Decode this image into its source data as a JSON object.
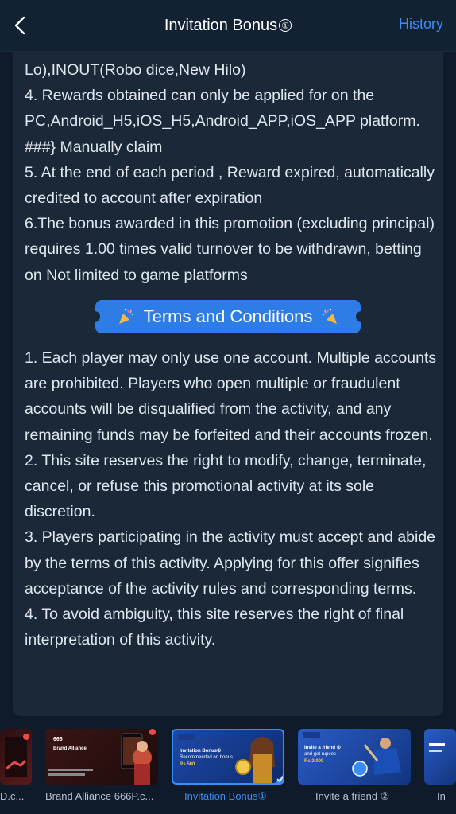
{
  "header": {
    "title": "Invitation Bonus",
    "info_icon": "①",
    "history_label": "History"
  },
  "rules": [
    "Lo),INOUT(Robo dice,New Hilo)",
    "4. Rewards obtained can only be applied for on the PC,Android_H5,iOS_H5,Android_APP,iOS_APP platform. ###} Manually claim",
    "5. At the end of each period , Reward expired, automatically credited to account after expiration",
    "6.The bonus awarded in this promotion (excluding principal) requires 1.00 times valid turnover to be withdrawn, betting on Not limited to game platforms"
  ],
  "terms_title": "Terms and Conditions",
  "terms": [
    "1. Each player may only use one account. Multiple accounts are prohibited. Players who open multiple or fraudulent accounts will be disqualified from the activity, and any remaining funds may be forfeited and their accounts frozen.",
    "2. This site reserves the right to modify, change, terminate, cancel, or refuse this promotional activity at its sole discretion.",
    "3. Players participating in the activity must accept and abide by the terms of this activity. Applying for this offer signifies acceptance of the activity rules and corresponding terms.",
    "4. To avoid ambiguity, this site reserves the right of final interpretation of this activity."
  ],
  "promos": [
    {
      "label": "D.c...",
      "active": false
    },
    {
      "label": "Brand Alliance 666P.c...",
      "active": false,
      "thumb_title": "Brand Alliance",
      "thumb_brand": "666"
    },
    {
      "label": "Invitation Bonus①",
      "active": true,
      "thumb_title": "Invitation Bonus①",
      "thumb_sub": "Recommended on bonus",
      "thumb_amount": "Rs 500"
    },
    {
      "label": "Invite a friend ②",
      "active": false,
      "thumb_title": "Invite a friend ②",
      "thumb_sub": "and get rupees",
      "thumb_amount": "Rs 2,000"
    },
    {
      "label": "In",
      "active": false
    }
  ],
  "colors": {
    "background": "#0f1b2b",
    "card": "#1a2838",
    "accent": "#2e7de6",
    "link": "#3a8df5"
  }
}
